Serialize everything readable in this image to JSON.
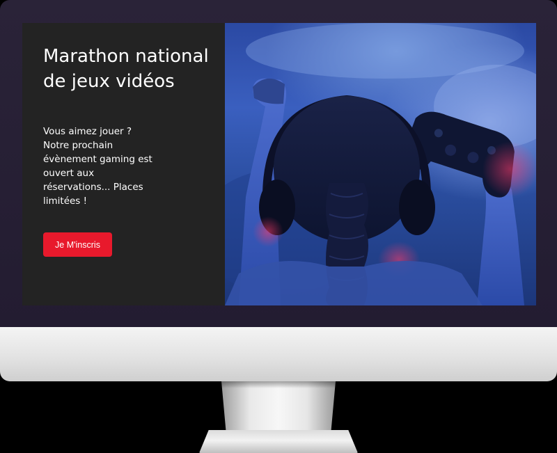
{
  "hero": {
    "title": "Marathon national\nde jeux vidéos",
    "description": "Vous aimez jouer ?\nNotre prochain\névènement gaming est\nouvert aux\nréservations... Places\nlimitées !",
    "cta_label": "Je M'inscris",
    "image_icon": "gamer-girl-headphones-controller-photo"
  },
  "colors": {
    "panel_bg": "#232323",
    "cta_bg": "#e8192c",
    "bezel": "#231c31"
  }
}
